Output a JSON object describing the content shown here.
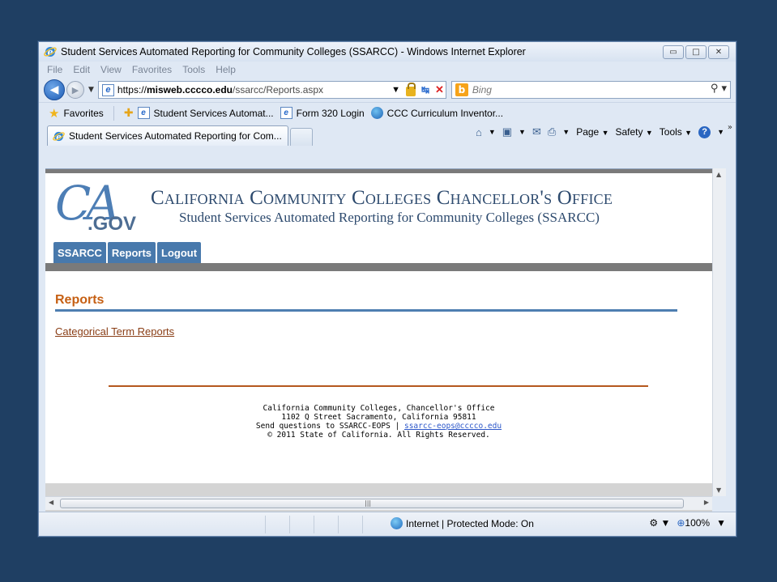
{
  "window": {
    "title": "Student Services Automated Reporting for Community Colleges (SSARCC) - Windows Internet Explorer",
    "controls": {
      "minimize": "▭",
      "maximize": "□",
      "close": "✕"
    }
  },
  "menubar": [
    "File",
    "Edit",
    "View",
    "Favorites",
    "Tools",
    "Help"
  ],
  "address": {
    "scheme": "https://",
    "host": "misweb.cccco.edu",
    "path": "/ssarcc/Reports.aspx"
  },
  "search": {
    "placeholder": "Bing"
  },
  "favorites": {
    "label": "Favorites",
    "items": [
      "Student Services Automat...",
      "Form 320 Login",
      "CCC Curriculum Inventor..."
    ]
  },
  "tab": {
    "title": "Student Services Automated Reporting for Com..."
  },
  "commandbar": {
    "page": "Page",
    "safety": "Safety",
    "tools": "Tools"
  },
  "site": {
    "logo_ca": "CA",
    "logo_gov": ".GOV",
    "title": "California Community Colleges Chancellor's Office",
    "subtitle": "Student Services Automated Reporting for Community Colleges (SSARCC)",
    "nav": [
      "SSARCC",
      "Reports",
      "Logout"
    ],
    "section_heading": "Reports",
    "link_categorical": "Categorical Term Reports",
    "footer": {
      "line1": "California Community Colleges, Chancellor's Office",
      "line2": "1102 Q Street Sacramento, California 95811",
      "line3_prefix": "Send questions to SSARCC-EOPS |",
      "email": "ssarcc-eops@cccco.edu",
      "line4": "© 2011 State of California. All Rights Reserved."
    }
  },
  "statusbar": {
    "zone": "Internet | Protected Mode: On",
    "zoom": "100%"
  },
  "colors": {
    "desktop": "#1f3f63",
    "accent_orange": "#c66014",
    "nav_blue": "#4879ac"
  }
}
